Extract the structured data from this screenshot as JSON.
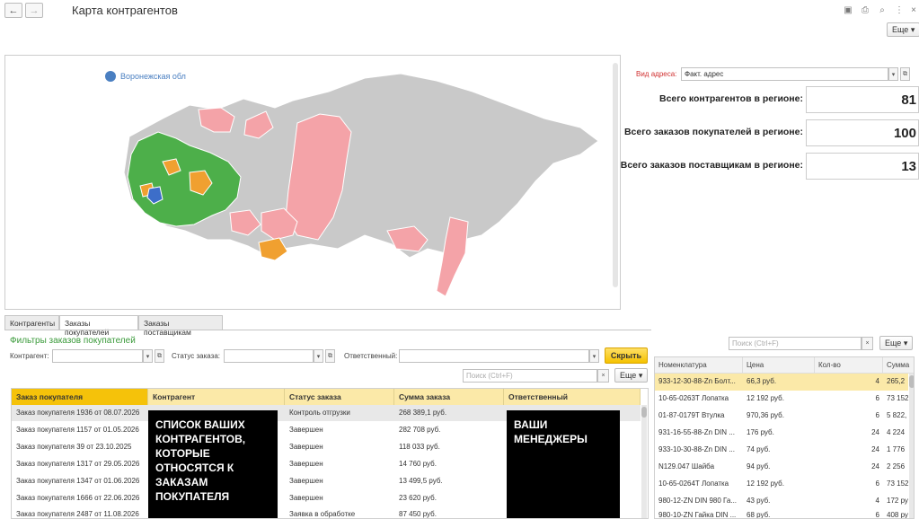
{
  "window": {
    "title": "Карта контрагентов",
    "more_label": "Еще",
    "back_glyph": "←",
    "forward_glyph": "→"
  },
  "map": {
    "legend": "Воронежская обл",
    "colors": {
      "gray": "#c9c9c9",
      "pink": "#f4a3a8",
      "green": "#4daf4a",
      "orange": "#f0a030",
      "blue": "#3d6ec9"
    }
  },
  "address": {
    "label": "Вид адреса:",
    "value": "Факт. адрес"
  },
  "stats": [
    {
      "label": "Всего контрагентов в регионе:",
      "value": "81"
    },
    {
      "label": "Всего заказов покупателей в регионе:",
      "value": "100"
    },
    {
      "label": "Всего заказов поставщикам в регионе:",
      "value": "13"
    }
  ],
  "tabs": [
    "Контрагенты",
    "Заказы покупателей",
    "Заказы поставщикам"
  ],
  "filters": {
    "title": "Фильтры заказов покупателей",
    "counterparty_label": "Контрагент:",
    "status_label": "Статус заказа:",
    "responsible_label": "Ответственный:",
    "hide_button": "Скрыть",
    "search_placeholder": "Поиск (Ctrl+F)",
    "more_label": "Еще"
  },
  "orders": {
    "columns": [
      "Заказ покупателя",
      "Контрагент",
      "Статус заказа",
      "Сумма заказа",
      "Ответственный"
    ],
    "rows": [
      {
        "order": "Заказ покупателя 1936 от 08.07.2026",
        "status": "Контроль отгрузки",
        "sum": "268 389,1 руб."
      },
      {
        "order": "Заказ покупателя 1157 от 01.05.2026",
        "status": "Завершен",
        "sum": "282 708 руб."
      },
      {
        "order": "Заказ покупателя 39 от 23.10.2025",
        "status": "Завершен",
        "sum": "118 033 руб."
      },
      {
        "order": "Заказ покупателя 1317 от 29.05.2026",
        "status": "Завершен",
        "sum": "14 760 руб."
      },
      {
        "order": "Заказ покупателя 1347 от 01.06.2026",
        "status": "Завершен",
        "sum": "13 499,5 руб."
      },
      {
        "order": "Заказ покупателя 1666 от 22.06.2026",
        "status": "Завершен",
        "sum": "23 620 руб."
      },
      {
        "order": "Заказ покупателя 2487 от 11.08.2026",
        "status": "Заявка в обработке",
        "sum": "87 450 руб."
      }
    ]
  },
  "overlays": {
    "counterparties": "СПИСОК ВАШИХ КОНТРАГЕНТОВ, КОТОРЫЕ ОТНОСЯТСЯ К ЗАКАЗАМ ПОКУПАТЕЛЯ",
    "managers": "ВАШИ МЕНЕДЖЕРЫ"
  },
  "items": {
    "search_placeholder": "Поиск (Ctrl+F)",
    "more_label": "Еще",
    "columns": [
      "Номенклатура",
      "Цена",
      "Кол-во",
      "Сумма"
    ],
    "rows": [
      {
        "name": "933-12-30-88-Zn Болт...",
        "price": "66,3 руб.",
        "qty": "4",
        "sum": "265,2"
      },
      {
        "name": "10-65-0263Т Лопатка",
        "price": "12 192 руб.",
        "qty": "6",
        "sum": "73 152"
      },
      {
        "name": "01-87-0179Т Втулка",
        "price": "970,36 руб.",
        "qty": "6",
        "sum": "5 822,"
      },
      {
        "name": "931-16-55-88-Zn DIN ...",
        "price": "176 руб.",
        "qty": "24",
        "sum": "4 224"
      },
      {
        "name": "933-10-30-88-Zn DIN ...",
        "price": "74 руб.",
        "qty": "24",
        "sum": "1 776"
      },
      {
        "name": "N129.047 Шайба",
        "price": "94 руб.",
        "qty": "24",
        "sum": "2 256"
      },
      {
        "name": "10-65-0264Т Лопатка",
        "price": "12 192 руб.",
        "qty": "6",
        "sum": "73 152"
      },
      {
        "name": "980-12-ZN DIN 980 Га...",
        "price": "43 руб.",
        "qty": "4",
        "sum": "172 ру"
      },
      {
        "name": "980-10-ZN Гайка DIN ...",
        "price": "68 руб.",
        "qty": "6",
        "sum": "408 ру"
      }
    ]
  }
}
